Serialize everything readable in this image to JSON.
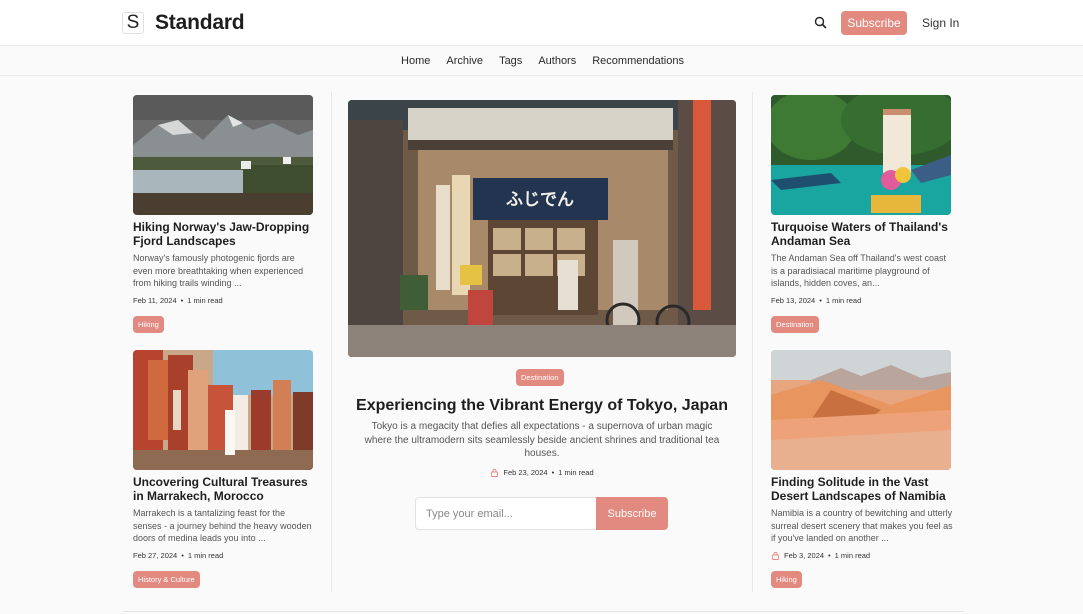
{
  "header": {
    "logo_mark": "S",
    "site_name": "Standard",
    "search_icon": "search-icon",
    "subscribe_label": "Subscribe",
    "signin_label": "Sign In"
  },
  "nav": {
    "items": [
      {
        "label": "Home"
      },
      {
        "label": "Archive"
      },
      {
        "label": "Tags"
      },
      {
        "label": "Authors"
      },
      {
        "label": "Recommendations"
      }
    ]
  },
  "posts": {
    "left": [
      {
        "title": "Hiking Norway's Jaw-Dropping Fjord Landscapes",
        "excerpt": "Norway's famously photogenic fjords are even more breathtaking when experienced from hiking trails winding ...",
        "date": "Feb 11, 2024",
        "read_time": "1 min read",
        "tag": "Hiking"
      },
      {
        "title": "Uncovering Cultural Treasures in Marrakech, Morocco",
        "excerpt": "Marrakech is a tantalizing feast for the senses - a journey behind the heavy wooden doors of medina leads you into ...",
        "date": "Feb 27, 2024",
        "read_time": "1 min read",
        "tag": "History & Culture"
      }
    ],
    "featured": {
      "tag": "Destination",
      "title": "Experiencing the Vibrant Energy of Tokyo, Japan",
      "excerpt": "Tokyo is a megacity that defies all expectations - a supernova of urban magic where the ultramodern sits seamlessly beside ancient shrines and traditional tea houses.",
      "date": "Feb 23, 2024",
      "read_time": "1 min read",
      "members_icon": "lock-icon",
      "sign_text": "ふじでん"
    },
    "right": [
      {
        "title": "Turquoise Waters of Thailand's Andaman Sea",
        "excerpt": "The Andaman Sea off Thailand's west coast is a paradisiacal maritime playground of islands, hidden coves, an...",
        "date": "Feb 13, 2024",
        "read_time": "1 min read",
        "tag": "Destination"
      },
      {
        "title": "Finding Solitude in the Vast Desert Landscapes of Namibia",
        "excerpt": "Namibia is a country of bewitching and utterly surreal desert scenery that makes you feel as if you've landed on another ...",
        "date": "Feb 3, 2024",
        "read_time": "1 min read",
        "tag": "Hiking",
        "members_icon": "lock-icon"
      }
    ]
  },
  "newsletter": {
    "placeholder": "Type your email...",
    "button_label": "Subscribe"
  },
  "meta_separator": "•",
  "colors": {
    "accent": "#e38a80",
    "text": "#1e1e1e",
    "muted": "#555555",
    "background": "#fbfafa"
  }
}
